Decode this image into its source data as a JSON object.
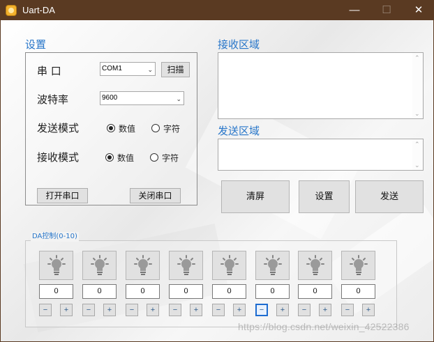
{
  "window": {
    "title": "Uart-DA",
    "controls": {
      "minimize": "—",
      "maximize": "☐",
      "close": "✕"
    }
  },
  "settings": {
    "title": "设置",
    "port_label": "串  口",
    "port_value": "COM1",
    "scan_label": "扫描",
    "baud_label": "波特率",
    "baud_value": "9600",
    "send_mode_label": "发送模式",
    "receive_mode_label": "接收模式",
    "send_mode_options": [
      {
        "label": "数值",
        "checked": true
      },
      {
        "label": "字符",
        "checked": false
      }
    ],
    "receive_mode_options": [
      {
        "label": "数值",
        "checked": true
      },
      {
        "label": "字符",
        "checked": false
      }
    ],
    "open_label": "打开串口",
    "close_label": "关闭串口"
  },
  "receive": {
    "title": "接收区域",
    "text": ""
  },
  "send": {
    "title": "发送区域",
    "text": ""
  },
  "actions": {
    "clear": "清屏",
    "settings": "设置",
    "send": "发送"
  },
  "da_control": {
    "title": "DA控制(0-10)",
    "channels": [
      {
        "value": "0"
      },
      {
        "value": "0"
      },
      {
        "value": "0"
      },
      {
        "value": "0"
      },
      {
        "value": "0"
      },
      {
        "value": "0"
      },
      {
        "value": "0"
      },
      {
        "value": "0"
      }
    ],
    "minus_label": "−",
    "plus_label": "+"
  },
  "watermark": "https://blog.csdn.net/weixin_42522386",
  "icons": {
    "app": "app-icon",
    "bulb": "lightbulb-icon",
    "dropdown": "chevron-down-icon"
  },
  "colors": {
    "titlebar": "#5a3a22",
    "section_title": "#2675c9",
    "focus": "#1c6bd0"
  }
}
